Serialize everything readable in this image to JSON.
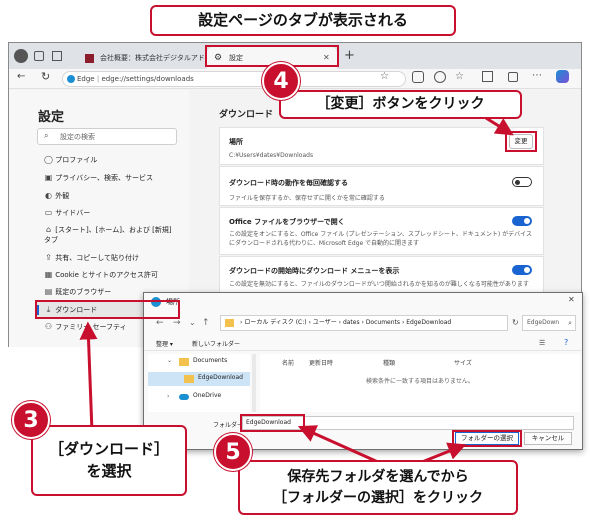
{
  "annotations": {
    "top_callout": "設定ページのタブが表示される",
    "step4_num": "4",
    "step4_text": "［変更］ボタンをクリック",
    "step3_num": "3",
    "step3_line1": "［ダウンロード］",
    "step3_line2": "を選択",
    "step5_num": "5",
    "step5_line1": "保存先フォルダを選んでから",
    "step5_line2": "［フォルダーの選択］をクリック"
  },
  "browser": {
    "tabs": [
      {
        "label": "会社概要：株式会社デジタルアド"
      },
      {
        "label": "設定"
      }
    ],
    "url_site": "Edge",
    "url_sep": " | ",
    "url_path": "edge://settings/downloads"
  },
  "sidebar": {
    "title": "設定",
    "search_placeholder": "設定の検索",
    "items": [
      {
        "label": "プロファイル",
        "icon": "profile-icon"
      },
      {
        "label": "プライバシー、検索、サービス",
        "icon": "lock-icon"
      },
      {
        "label": "外観",
        "icon": "appearance-icon"
      },
      {
        "label": "サイドバー",
        "icon": "sidebar-icon"
      },
      {
        "label": "[スタート]、[ホーム]、および [新規] タブ",
        "icon": "home-icon"
      },
      {
        "label": "共有、コピーして貼り付け",
        "icon": "share-icon"
      },
      {
        "label": "Cookie とサイトのアクセス許可",
        "icon": "cookie-icon"
      },
      {
        "label": "既定のブラウザー",
        "icon": "browser-icon"
      },
      {
        "label": "ダウンロード",
        "icon": "download-icon"
      },
      {
        "label": "ファミリー セーフティ",
        "icon": "family-icon"
      }
    ]
  },
  "downloads": {
    "title": "ダウンロード",
    "location_label": "場所",
    "location_path": "C:¥Users¥dates¥Downloads",
    "change_button": "変更",
    "ask_title": "ダウンロード時の動作を毎回確認する",
    "ask_desc": "ファイルを保存するか、保存せずに開くかを常に確認する",
    "office_title": "Office ファイルをブラウザーで開く",
    "office_desc": "この設定をオンにすると、Office ファイル (プレゼンテーション、スプレッドシート、ドキュメント) がデバイスにダウンロードされる代わりに、Microsoft Edge で自動的に開きます",
    "menu_title": "ダウンロードの開始時にダウンロード メニューを表示",
    "menu_desc": "この設定を無効にすると、ファイルのダウンロードがいつ開始されるかを知るのが難しくなる可能性があります"
  },
  "dialog": {
    "title": "場所",
    "breadcrumb": [
      "ローカル ディスク (C:)",
      "ユーザー",
      "dates",
      "Documents",
      "EdgeDownload"
    ],
    "search_placeholder": "EdgeDown",
    "organize": "整理",
    "new_folder": "新しいフォルダー",
    "tree": [
      {
        "label": "Documents"
      },
      {
        "label": "EdgeDownload"
      },
      {
        "label": "OneDrive"
      }
    ],
    "columns": [
      "名前",
      "更新日時",
      "種類",
      "サイズ"
    ],
    "empty_message": "検索条件に一致する項目はありません。",
    "folder_label": "フォルダー:",
    "folder_value": "EdgeDownload",
    "select_button": "フォルダーの選択",
    "cancel_button": "キャンセル"
  },
  "colors": {
    "accent": "#c8102e",
    "edge_blue": "#1a64d2",
    "folder": "#f2c14e"
  }
}
